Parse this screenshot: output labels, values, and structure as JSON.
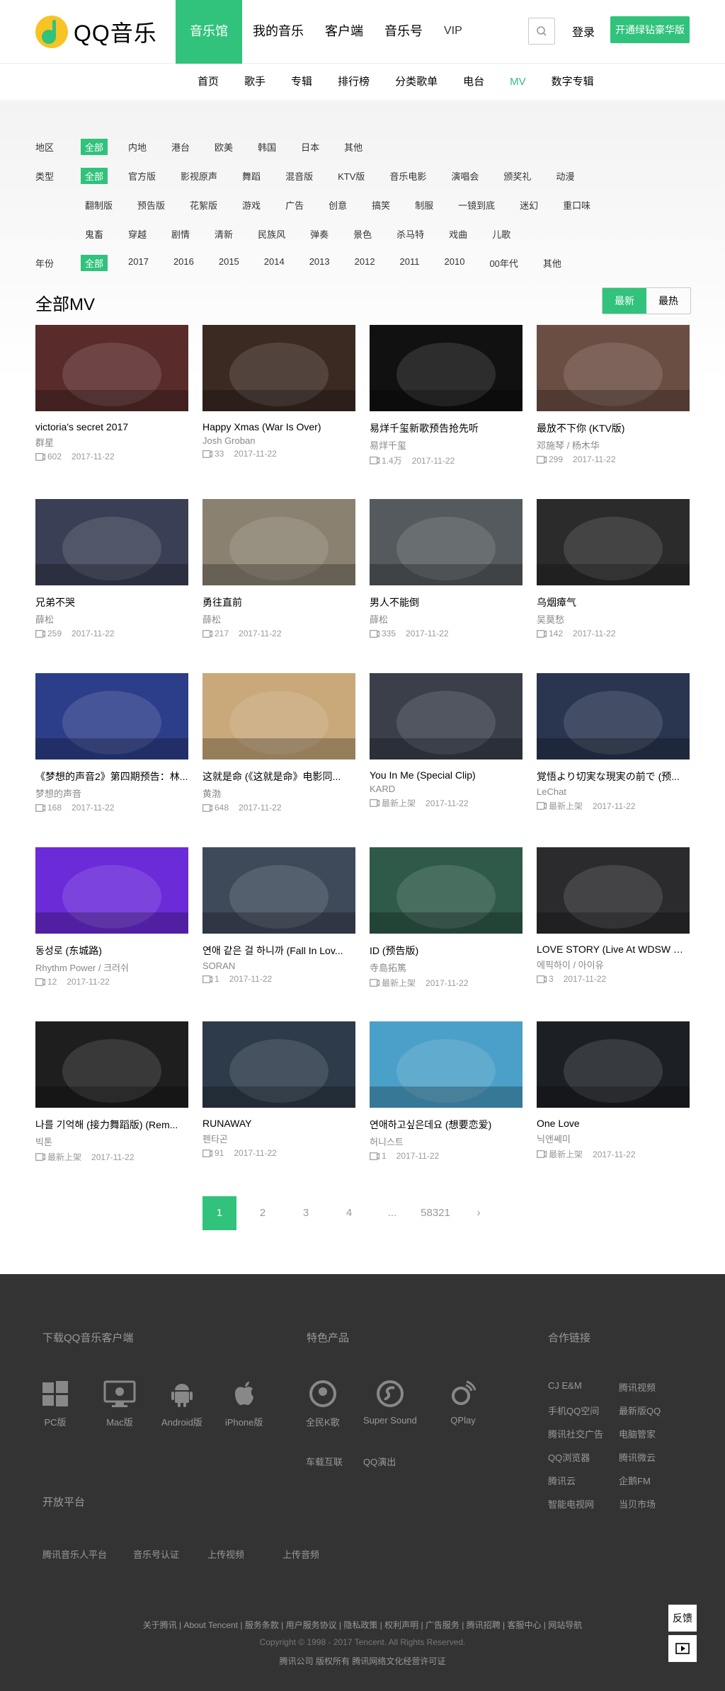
{
  "brand": {
    "logo_text": "QQ音乐"
  },
  "header": {
    "nav": [
      "音乐馆",
      "我的音乐",
      "客户端",
      "音乐号",
      "VIP"
    ],
    "login": "登录",
    "vip_btn": "开通绿钻豪华版"
  },
  "subnav": [
    "首页",
    "歌手",
    "专辑",
    "排行榜",
    "分类歌单",
    "电台",
    "MV",
    "数字专辑"
  ],
  "filters": {
    "area": {
      "label": "地区",
      "opts": [
        "全部",
        "内地",
        "港台",
        "欧美",
        "韩国",
        "日本",
        "其他"
      ]
    },
    "type": {
      "label": "类型",
      "opts": [
        "全部",
        "官方版",
        "影视原声",
        "舞蹈",
        "混音版",
        "KTV版",
        "音乐电影",
        "演唱会",
        "颁奖礼",
        "动漫"
      ]
    },
    "type2": [
      "翻制版",
      "预告版",
      "花絮版",
      "游戏",
      "广告",
      "创意",
      "搞笑",
      "制服",
      "一镜到底",
      "迷幻",
      "重口味"
    ],
    "type3": [
      "鬼畜",
      "穿越",
      "剧情",
      "清新",
      "民族风",
      "弹奏",
      "景色",
      "杀马特",
      "戏曲",
      "儿歌"
    ],
    "year": {
      "label": "年份",
      "opts": [
        "全部",
        "2017",
        "2016",
        "2015",
        "2014",
        "2013",
        "2012",
        "2011",
        "2010",
        "00年代",
        "其他"
      ]
    }
  },
  "section": {
    "title": "全部MV",
    "sort_new": "最新",
    "sort_hot": "最热"
  },
  "mvs": [
    {
      "title": "victoria's secret 2017",
      "singer": "群星",
      "plays": "602",
      "date": "2017-11-22",
      "color": "#5a2b2b"
    },
    {
      "title": "Happy Xmas (War Is Over)",
      "singer": "Josh Groban",
      "plays": "33",
      "date": "2017-11-22",
      "color": "#3b2a22"
    },
    {
      "title": "易烊千玺新歌预告抢先听",
      "singer": "易烊千玺",
      "plays": "1.4万",
      "date": "2017-11-22",
      "color": "#111111"
    },
    {
      "title": "最放不下你 (KTV版)",
      "singer": "邓施琴 / 杨木华",
      "plays": "299",
      "date": "2017-11-22",
      "color": "#6b4e43"
    },
    {
      "title": "兄弟不哭",
      "singer": "薛松",
      "plays": "259",
      "date": "2017-11-22",
      "color": "#3a3f55"
    },
    {
      "title": "勇往直前",
      "singer": "薛松",
      "plays": "217",
      "date": "2017-11-22",
      "color": "#8a8170"
    },
    {
      "title": "男人不能倒",
      "singer": "薛松",
      "plays": "335",
      "date": "2017-11-22",
      "color": "#555a5e"
    },
    {
      "title": "乌烟瘴气",
      "singer": "吴莫愁",
      "plays": "142",
      "date": "2017-11-22",
      "color": "#2b2b2b"
    },
    {
      "title": "《梦想的声音2》第四期预告：林...",
      "singer": "梦想的声音",
      "plays": "168",
      "date": "2017-11-22",
      "color": "#2c3e8a"
    },
    {
      "title": "这就是命 (《这就是命》电影同...",
      "singer": "黄渤",
      "plays": "648",
      "date": "2017-11-22",
      "color": "#c9a87a"
    },
    {
      "title": "You In Me (Special Clip)",
      "singer": "KARD",
      "plays": "最新上架",
      "date": "2017-11-22",
      "color": "#3a3f4a"
    },
    {
      "title": "覚悟より切実な現実の前で (预...",
      "singer": "LeChat",
      "plays": "最新上架",
      "date": "2017-11-22",
      "color": "#2a3550"
    },
    {
      "title": "동성로 (东城路)",
      "singer": "Rhythm Power / 크러쉬",
      "plays": "12",
      "date": "2017-11-22",
      "color": "#6c2bd9"
    },
    {
      "title": "연애 같은 걸 하니까 (Fall In Lov...",
      "singer": "SORAN",
      "plays": "1",
      "date": "2017-11-22",
      "color": "#3e4a5a"
    },
    {
      "title": "ID (预告版)",
      "singer": "寺島拓篤",
      "plays": "最新上架",
      "date": "2017-11-22",
      "color": "#2f5a4a"
    },
    {
      "title": "LOVE STORY (Live At WDSW Co...",
      "singer": "에픽하이 / 아이유",
      "plays": "3",
      "date": "2017-11-22",
      "color": "#2b2b2e"
    },
    {
      "title": "나를 기억해 (接力舞蹈版) (Rem...",
      "singer": "빅톤",
      "plays": "最新上架",
      "date": "2017-11-22",
      "color": "#1e1e1e"
    },
    {
      "title": "RUNAWAY",
      "singer": "펜타곤",
      "plays": "91",
      "date": "2017-11-22",
      "color": "#2d3b4a"
    },
    {
      "title": "연애하고싶은데요 (想要恋爱)",
      "singer": "허니스트",
      "plays": "1",
      "date": "2017-11-22",
      "color": "#4aa0c8"
    },
    {
      "title": "One Love",
      "singer": "닉앤쎄미",
      "plays": "最新上架",
      "date": "2017-11-22",
      "color": "#1c1f24"
    }
  ],
  "pager": [
    "1",
    "2",
    "3",
    "4",
    "...",
    "58321",
    "›"
  ],
  "footer": {
    "download_title": "下载QQ音乐客户端",
    "apps": [
      "PC版",
      "Mac版",
      "Android版",
      "iPhone版"
    ],
    "products_title": "特色产品",
    "products": [
      "全民K歌",
      "Super Sound",
      "QPlay"
    ],
    "products2": [
      "车载互联",
      "QQ演出"
    ],
    "partners_title": "合作链接",
    "partners": [
      "CJ E&M",
      "腾讯视频",
      "手机QQ空间",
      "最新版QQ",
      "腾讯社交广告",
      "电脑管家",
      "QQ浏览器",
      "腾讯微云",
      "腾讯云",
      "企鹅FM",
      "智能电视网",
      "当贝市场"
    ],
    "open_title": "开放平台",
    "open_links": [
      "腾讯音乐人平台",
      "音乐号认证",
      "上传视频",
      "上传音频"
    ],
    "legal_links": "关于腾讯 | About Tencent | 服务条款 | 用户服务协议 | 隐私政策 | 权利声明 | 广告服务 | 腾讯招聘 | 客服中心 | 网站导航",
    "copyright": "Copyright © 1998 - 2017 Tencent. All Rights Reserved.",
    "company": "腾讯公司 版权所有 腾讯网络文化经营许可证",
    "feedback": "反馈"
  }
}
